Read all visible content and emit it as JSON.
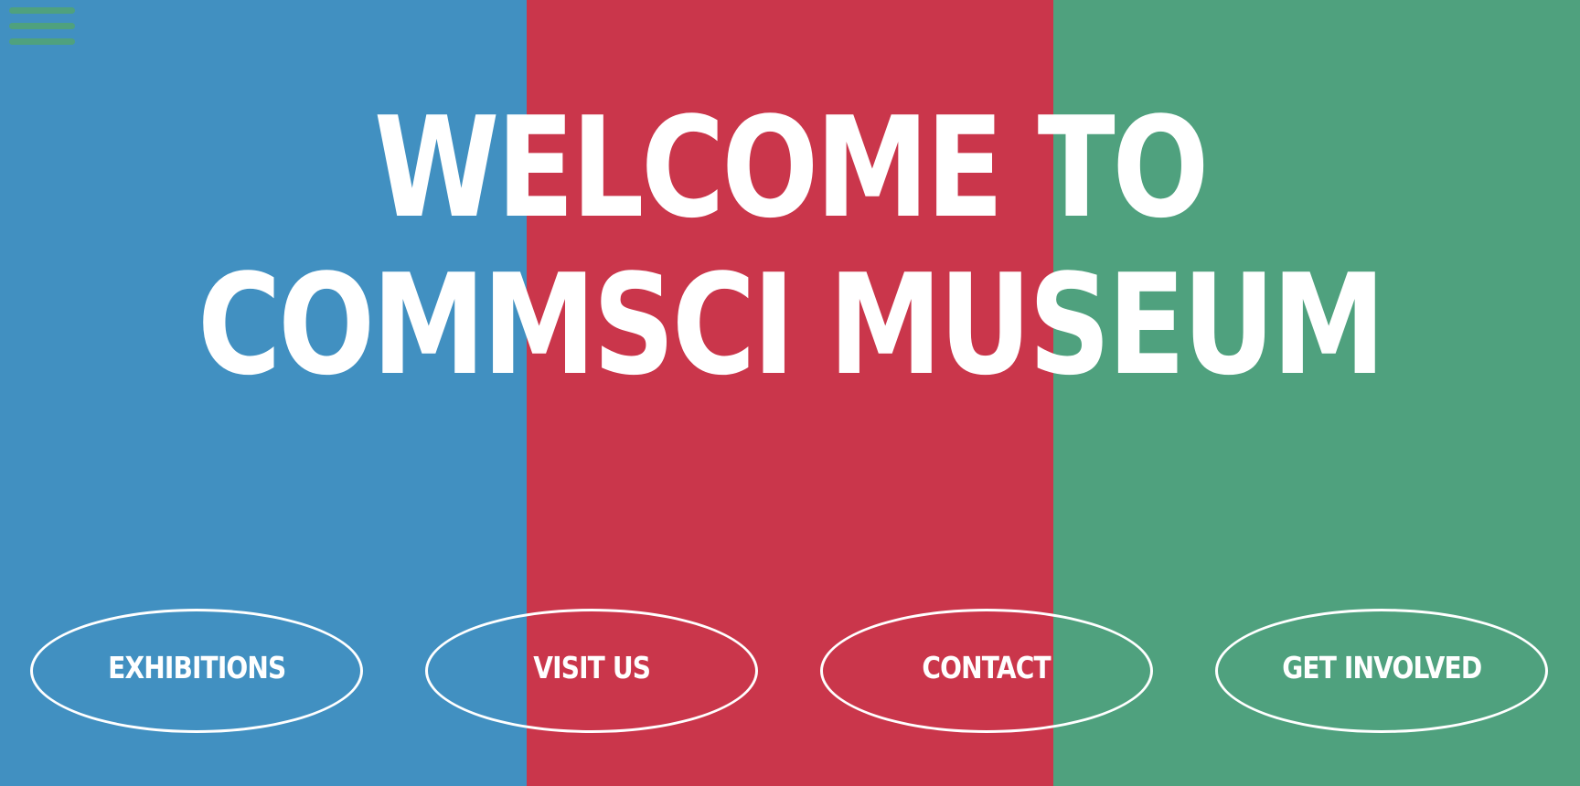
{
  "colors": {
    "stripe_blue": "#4190c1",
    "stripe_red": "#ca364b",
    "stripe_green": "#4fa17e",
    "menu_icon": "#4fa17e",
    "text": "#ffffff"
  },
  "menu": {
    "icon": "hamburger-menu-icon"
  },
  "hero": {
    "line1": "WELCOME TO",
    "line2": "COMMSCI MUSEUM"
  },
  "nav": {
    "items": [
      {
        "label": "EXHIBITIONS"
      },
      {
        "label": "VISIT US"
      },
      {
        "label": "CONTACT"
      },
      {
        "label": "GET INVOLVED"
      }
    ]
  }
}
